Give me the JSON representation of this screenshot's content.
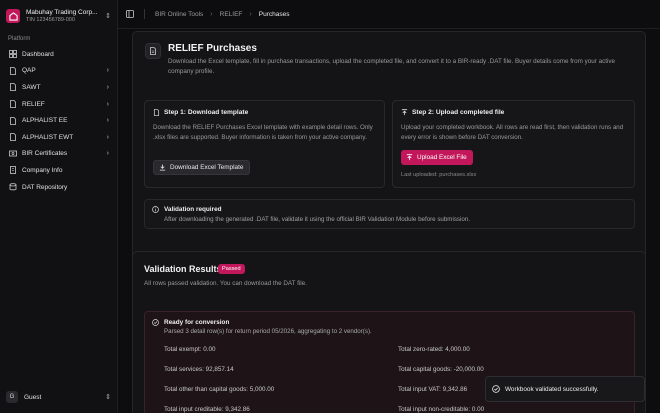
{
  "sidebar": {
    "company_name": "Mabuhay Trading Corp...",
    "company_tin": "TIN 123456789-000",
    "section_label": "Platform",
    "items": [
      {
        "label": "Dashboard",
        "icon": "dashboard-icon",
        "chevron": false
      },
      {
        "label": "QAP",
        "icon": "document-icon",
        "chevron": true
      },
      {
        "label": "SAWT",
        "icon": "document-icon",
        "chevron": true
      },
      {
        "label": "RELIEF",
        "icon": "document-icon",
        "chevron": true
      },
      {
        "label": "ALPHALIST EE",
        "icon": "document-icon",
        "chevron": true
      },
      {
        "label": "ALPHALIST EWT",
        "icon": "document-icon",
        "chevron": true
      },
      {
        "label": "BIR Certificates",
        "icon": "certificate-icon",
        "chevron": true
      },
      {
        "label": "Company Info",
        "icon": "building-icon",
        "chevron": false
      },
      {
        "label": "DAT Repository",
        "icon": "database-icon",
        "chevron": false
      }
    ],
    "user_initial": "G",
    "user_label": "Guest"
  },
  "topbar": {
    "breadcrumbs": [
      "BIR Online Tools",
      "RELIEF",
      "Purchases"
    ]
  },
  "purchases": {
    "title": "RELIEF Purchases",
    "description": "Download the Excel template, fill in purchase transactions, upload the completed file, and convert it to a BIR-ready .DAT file. Buyer details come from your active company profile.",
    "step1_title": "Step 1: Download template",
    "step1_desc": "Download the RELIEF Purchases Excel template with example detail rows. Only .xlsx files are supported. Buyer information is taken from your active company.",
    "download_button": "Download Excel Template",
    "step2_title": "Step 2: Upload completed file",
    "step2_desc": "Upload your completed workbook. All rows are read first, then validation runs and every error is shown before DAT conversion.",
    "upload_button": "Upload Excel File",
    "last_uploaded": "Last uploaded: purchases.xlsx",
    "validation_required_title": "Validation required",
    "validation_required_desc": "After downloading the generated .DAT file, validate it using the official BIR Validation Module before submission."
  },
  "results": {
    "title": "Validation Results",
    "badge": "Passed",
    "desc": "All rows passed validation. You can download the DAT file.",
    "ready_title": "Ready for conversion",
    "ready_desc": "Parsed 3 detail row(s) for return period 05/2026, aggregating to 2 vendor(s).",
    "totals": [
      "Total exempt: 0.00",
      "Total zero-rated: 4,000.00",
      "Total services: 92,857.14",
      "Total capital goods: -20,000.00",
      "Total other than capital goods: 5,000.00",
      "Total input VAT: 9,342.86",
      "Total input creditable: 9,342.86",
      "Total input non-creditable: 0.00"
    ]
  },
  "toast": {
    "message": "Workbook validated successfully."
  },
  "colors": {
    "accent": "#c2185b",
    "background": "#0d0d0f",
    "card": "#141416"
  }
}
